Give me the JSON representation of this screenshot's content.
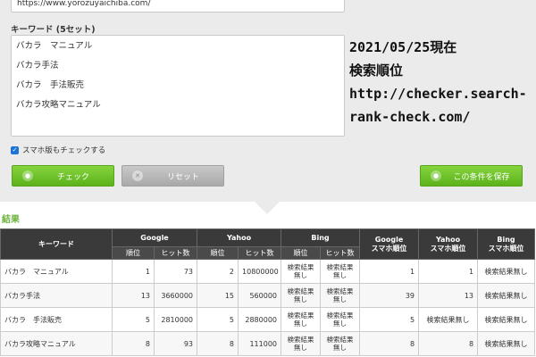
{
  "form": {
    "url_value": "https://www.yorozuyaichiba.com/",
    "keywords_label": "キーワード (5セット)",
    "keywords": [
      "バカラ　マニュアル",
      "バカラ手法",
      "バカラ　手法販売",
      "バカラ攻略マニュアル"
    ],
    "smartphone_check_label": "スマホ版もチェックする",
    "check_button": "チェック",
    "reset_button": "リセット",
    "save_button": "この条件を保存"
  },
  "overlay_text": {
    "line1": "2021/05/25現在",
    "line2": "検索順位",
    "line3": "http://checker.search-",
    "line4": "rank-check.com/"
  },
  "results": {
    "title": "結果",
    "headers": {
      "keyword": "キーワード",
      "google": "Google",
      "yahoo": "Yahoo",
      "bing": "Bing",
      "google_sp": "Google\nスマホ順位",
      "yahoo_sp": "Yahoo\nスマホ順位",
      "bing_sp": "Bing\nスマホ順位",
      "rank": "順位",
      "hits": "ヒット数"
    },
    "rows": [
      {
        "keyword": "バカラ　マニュアル",
        "g_rank": "1",
        "g_hits": "73",
        "y_rank": "2",
        "y_hits": "10800000",
        "b_rank": "検索結果無し",
        "b_hits": "検索結果無し",
        "g_sp": "1",
        "y_sp": "1",
        "b_sp": "検索結果無し"
      },
      {
        "keyword": "バカラ手法",
        "g_rank": "13",
        "g_hits": "3660000",
        "y_rank": "15",
        "y_hits": "560000",
        "b_rank": "検索結果無し",
        "b_hits": "検索結果無し",
        "g_sp": "39",
        "y_sp": "13",
        "b_sp": "検索結果無し"
      },
      {
        "keyword": "バカラ　手法販売",
        "g_rank": "5",
        "g_hits": "2810000",
        "y_rank": "5",
        "y_hits": "2880000",
        "b_rank": "検索結果無し",
        "b_hits": "検索結果無し",
        "g_sp": "5",
        "y_sp": "検索結果無し",
        "b_sp": "検索結果無し"
      },
      {
        "keyword": "バカラ攻略マニュアル",
        "g_rank": "8",
        "g_hits": "93",
        "y_rank": "8",
        "y_hits": "111000",
        "b_rank": "検索結果無し",
        "b_hits": "検索結果無し",
        "g_sp": "8",
        "y_sp": "8",
        "b_sp": "検索結果無し"
      }
    ]
  }
}
